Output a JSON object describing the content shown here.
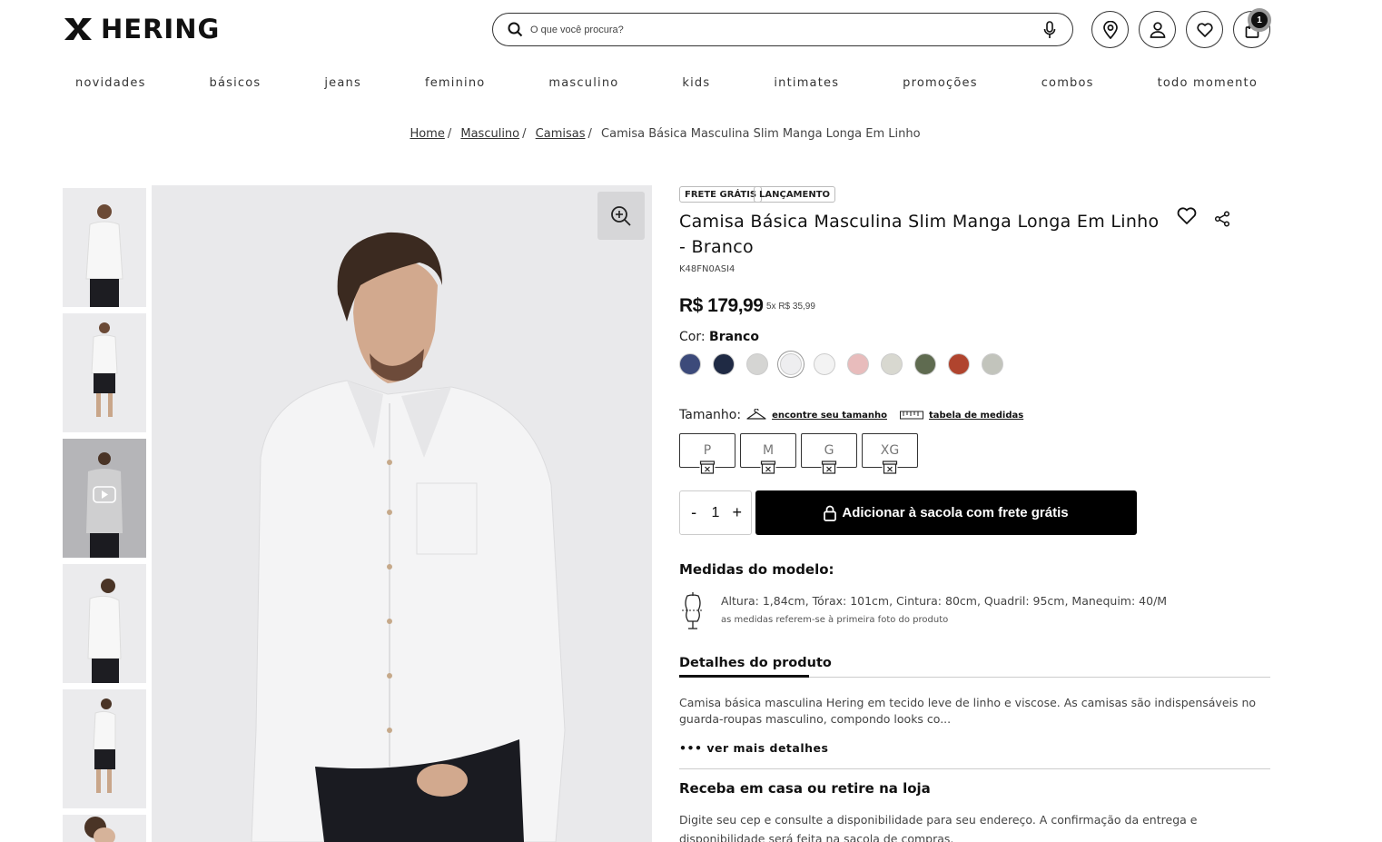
{
  "brand": {
    "name": "HERING"
  },
  "search": {
    "placeholder": "O que você procura?"
  },
  "cart": {
    "count": "1"
  },
  "nav": [
    "novidades",
    "básicos",
    "jeans",
    "feminino",
    "masculino",
    "kids",
    "intimates",
    "promoções",
    "combos",
    "todo momento"
  ],
  "breadcrumb": {
    "home": "Home",
    "level1": "Masculino",
    "level2": "Camisas",
    "current": "Camisa Básica Masculina Slim Manga Longa Em Linho"
  },
  "product": {
    "tags": [
      "FRETE GRÁTIS",
      "LANÇAMENTO"
    ],
    "title": "Camisa Básica Masculina Slim Manga Longa Em Linho - Branco",
    "sku": "K48FN0ASI4",
    "price": "R$ 179,99",
    "installments": "5x R$ 35,99",
    "color_label": "Cor:",
    "color_value": "Branco",
    "swatches": [
      "#3c4a7a",
      "#1f2a44",
      "#d5d5d3",
      "#eeeef0",
      "#f3f3f3",
      "#e8bcbc",
      "#d8d8d0",
      "#5f6b50",
      "#b0442e",
      "#c2c4bc"
    ],
    "size_label": "Tamanho:",
    "find_size": "encontre seu tamanho",
    "size_chart": "tabela de medidas",
    "sizes": [
      "P",
      "M",
      "G",
      "XG"
    ],
    "quantity": "1",
    "qty_minus": "-",
    "qty_plus": "+",
    "add_to_bag": "Adicionar à sacola com frete grátis",
    "model_heading": "Medidas do modelo:",
    "model_measures": "Altura: 1,84cm, Tórax: 101cm, Cintura: 80cm, Quadril: 95cm, Manequim: 40/M",
    "model_note": "as medidas referem-se à primeira foto do produto",
    "details_tab": "Detalhes do produto",
    "description": "Camisa básica masculina Hering em tecido leve de linho e viscose. As camisas são indispensáveis no guarda-roupas masculino, compondo looks co...",
    "see_more": "••• ver mais detalhes",
    "delivery_heading": "Receba em casa ou retire na loja",
    "delivery_text": "Digite seu cep e consulte a disponibilidade para seu endereço. A confirmação da entrega e disponibilidade será feita na sacola de compras."
  }
}
